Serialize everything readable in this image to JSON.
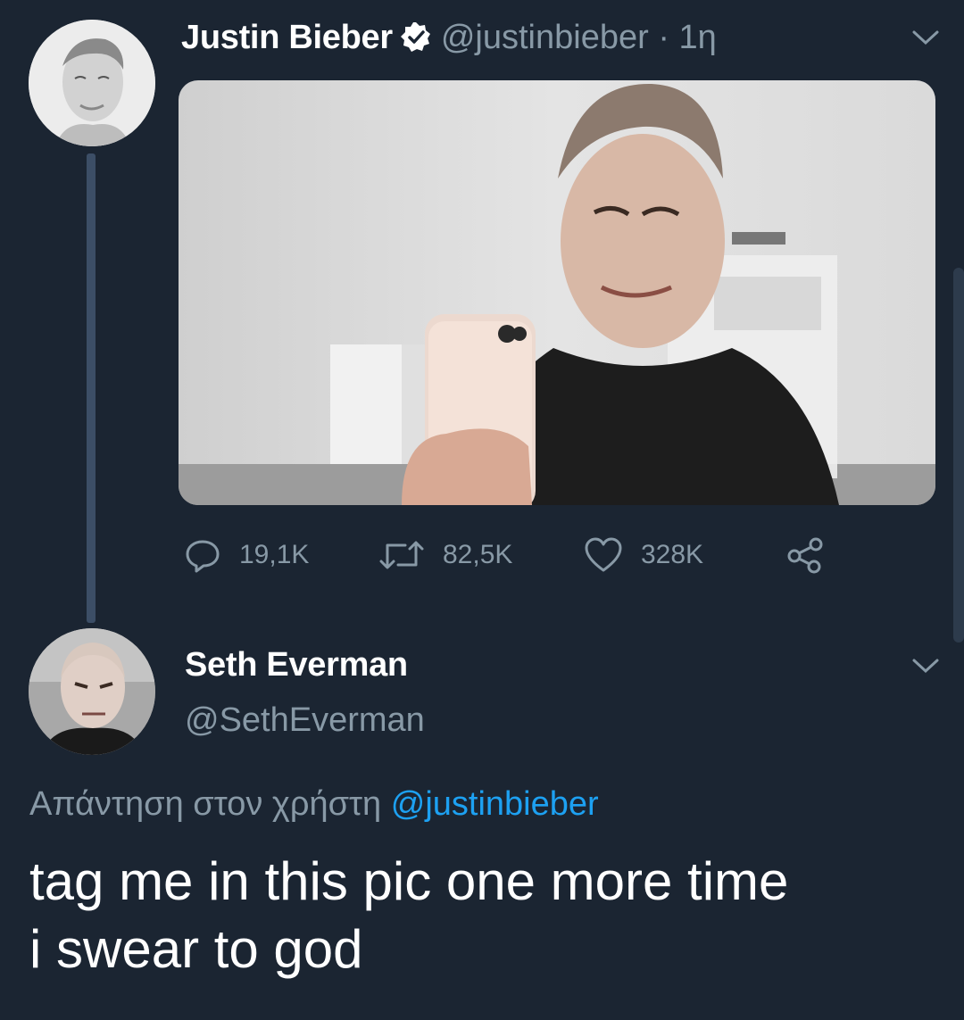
{
  "original_tweet": {
    "author_name": "Justin Bieber",
    "author_handle": "@justinbieber",
    "time_separator": " · ",
    "time": "1η",
    "verified": true,
    "stats": {
      "replies": "19,1K",
      "retweets": "82,5K",
      "likes": "328K"
    },
    "icons": [
      "reply-icon",
      "retweet-icon",
      "like-icon",
      "share-icon",
      "verified-badge-icon",
      "chevron-down-icon"
    ]
  },
  "reply_tweet": {
    "author_name": "Seth Everman",
    "author_handle": "@SethEverman",
    "reply_prefix": "Απάντηση στον χρήστη",
    "reply_to_mention": "@justinbieber",
    "text_line1": "tag me in this pic one more time",
    "text_line2": "i swear to god"
  },
  "colors": {
    "background": "#1b2532",
    "secondary_text": "#8899a6",
    "link": "#1da1f2",
    "thread_line": "#3c4e66"
  }
}
